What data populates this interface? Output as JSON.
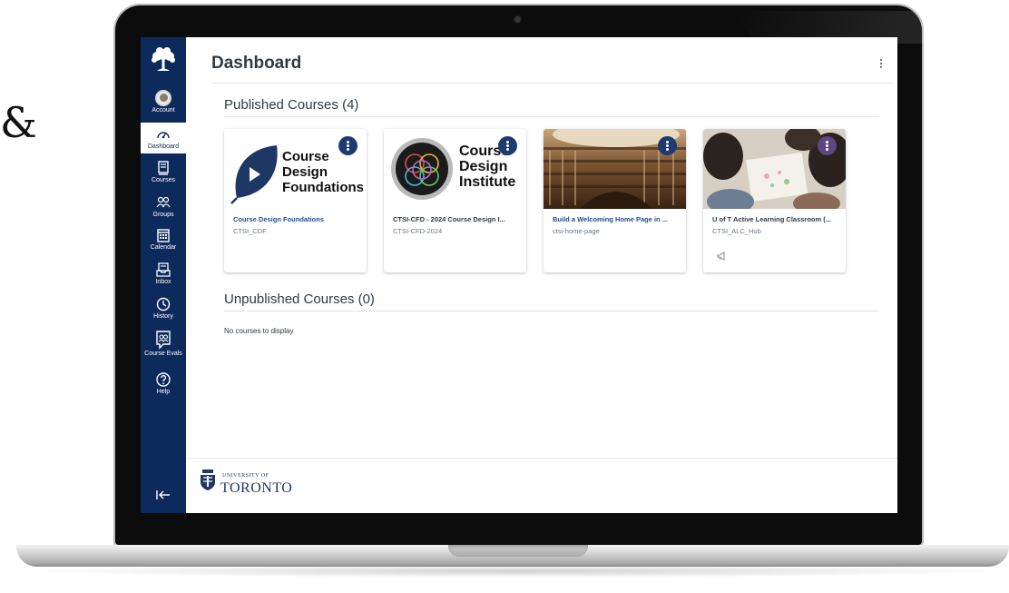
{
  "stray_glyph": "&",
  "nav": {
    "items": [
      {
        "label": "Account",
        "icon": "account-avatar-icon"
      },
      {
        "label": "Dashboard",
        "icon": "dashboard-gauge-icon"
      },
      {
        "label": "Courses",
        "icon": "courses-book-icon"
      },
      {
        "label": "Groups",
        "icon": "groups-people-icon"
      },
      {
        "label": "Calendar",
        "icon": "calendar-icon"
      },
      {
        "label": "Inbox",
        "icon": "inbox-icon"
      },
      {
        "label": "History",
        "icon": "history-clock-icon"
      },
      {
        "label": "Course Evals",
        "icon": "course-evals-icon"
      },
      {
        "label": "Help",
        "icon": "help-icon"
      }
    ],
    "active": "Dashboard",
    "colors": {
      "nav_bg": "#0d2a5c",
      "active_bg": "#ffffff"
    }
  },
  "header": {
    "title": "Dashboard"
  },
  "published": {
    "heading": "Published Courses (4)",
    "cards": [
      {
        "title": "Course Design Foundations",
        "code": "CTSI_CDF",
        "hero_lines": [
          "Course",
          "Design",
          "Foundations"
        ],
        "kebab_color": "#1f3a6e"
      },
      {
        "title": "CTSI-CFD - 2024 Course Design I...",
        "code": "CTSI-CFD-2024",
        "hero_lines": [
          "Course",
          "Design",
          "Institute"
        ],
        "kebab_color": "#1f3a6e"
      },
      {
        "title": "Build a Welcoming Home Page in ...",
        "code": "ctsi-home-page",
        "kebab_color": "#1f3a6e"
      },
      {
        "title": "U of T Active Learning Classroom (...",
        "code": "CTSI_ALC_Hub",
        "kebab_color": "#5e4780",
        "has_announcement": true
      }
    ]
  },
  "unpublished": {
    "heading": "Unpublished Courses (0)",
    "empty_text": "No courses to display"
  },
  "footer": {
    "brand_small": "UNIVERSITY OF",
    "brand_big": "TORONTO"
  }
}
